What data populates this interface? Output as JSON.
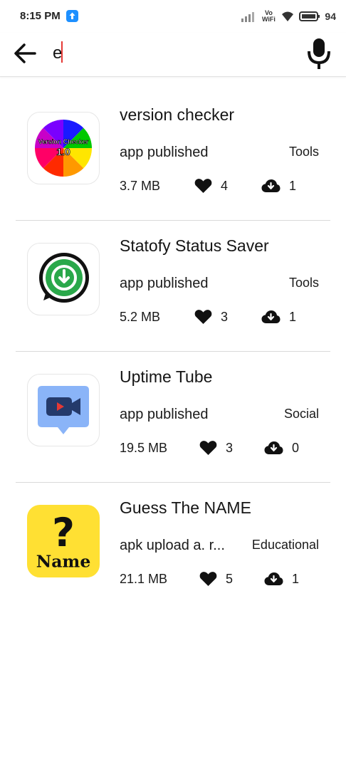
{
  "status_bar": {
    "time": "8:15 PM",
    "vowifi_top": "Vo",
    "vowifi_bottom": "WiFi",
    "battery": "94"
  },
  "search": {
    "query": "e"
  },
  "apps": [
    {
      "name": "version checker",
      "status": "app published",
      "category": "Tools",
      "size": "3.7 MB",
      "likes": "4",
      "downloads": "1",
      "icon": "version-checker-icon"
    },
    {
      "name": "Statofy Status Saver",
      "status": "app published",
      "category": "Tools",
      "size": "5.2 MB",
      "likes": "3",
      "downloads": "1",
      "icon": "statofy-icon"
    },
    {
      "name": "Uptime Tube",
      "status": "app published",
      "category": "Social",
      "size": "19.5 MB",
      "likes": "3",
      "downloads": "0",
      "icon": "uptime-tube-icon"
    },
    {
      "name": "Guess The NAME",
      "status": "apk upload a. r...",
      "category": "Educational",
      "size": "21.1 MB",
      "likes": "5",
      "downloads": "1",
      "icon": "guess-the-name-icon"
    }
  ],
  "icon_texts": {
    "version_checker_title": "Version Checker",
    "version_checker_version": "1.0",
    "guess_symbol": "?",
    "guess_word": "Name"
  },
  "colors": {
    "accent_caret": "#e53935",
    "upload_badge": "#1e90ff",
    "divider": "#d9d9d9"
  }
}
